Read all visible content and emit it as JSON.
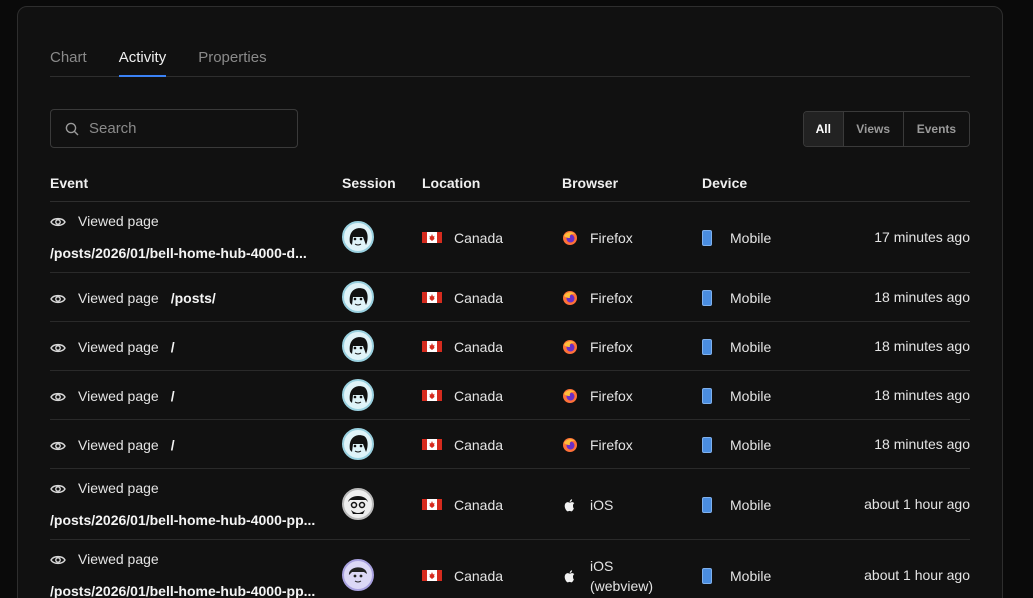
{
  "tabs": [
    {
      "label": "Chart",
      "active": false
    },
    {
      "label": "Activity",
      "active": true
    },
    {
      "label": "Properties",
      "active": false
    }
  ],
  "search": {
    "placeholder": "Search",
    "value": ""
  },
  "filter": {
    "options": [
      "All",
      "Views",
      "Events"
    ],
    "selected": "All"
  },
  "columns": {
    "event": "Event",
    "session": "Session",
    "location": "Location",
    "browser": "Browser",
    "device": "Device"
  },
  "colors": {
    "accent": "#3b82f6",
    "background": "#111111"
  },
  "rows": [
    {
      "event": "Viewed page",
      "path": "/posts/2026/01/bell-home-hub-4000-d...",
      "avatar": "avatar-a",
      "location": "Canada",
      "browser": "Firefox",
      "browser_icon": "firefox-icon",
      "device": "Mobile",
      "time": "17 minutes ago",
      "twoLine": true
    },
    {
      "event": "Viewed page",
      "path": "/posts/",
      "avatar": "avatar-a",
      "location": "Canada",
      "browser": "Firefox",
      "browser_icon": "firefox-icon",
      "device": "Mobile",
      "time": "18 minutes ago",
      "twoLine": false
    },
    {
      "event": "Viewed page",
      "path": "/",
      "avatar": "avatar-a",
      "location": "Canada",
      "browser": "Firefox",
      "browser_icon": "firefox-icon",
      "device": "Mobile",
      "time": "18 minutes ago",
      "twoLine": false
    },
    {
      "event": "Viewed page",
      "path": "/",
      "avatar": "avatar-a",
      "location": "Canada",
      "browser": "Firefox",
      "browser_icon": "firefox-icon",
      "device": "Mobile",
      "time": "18 minutes ago",
      "twoLine": false
    },
    {
      "event": "Viewed page",
      "path": "/",
      "avatar": "avatar-a",
      "location": "Canada",
      "browser": "Firefox",
      "browser_icon": "firefox-icon",
      "device": "Mobile",
      "time": "18 minutes ago",
      "twoLine": false
    },
    {
      "event": "Viewed page",
      "path": "/posts/2026/01/bell-home-hub-4000-pp...",
      "avatar": "avatar-b",
      "location": "Canada",
      "browser": "iOS",
      "browser_icon": "apple-icon",
      "device": "Mobile",
      "time": "about 1 hour ago",
      "twoLine": true
    },
    {
      "event": "Viewed page",
      "path": "/posts/2026/01/bell-home-hub-4000-pp...",
      "avatar": "avatar-c",
      "location": "Canada",
      "browser": "iOS\n(webview)",
      "browser_icon": "apple-icon",
      "device": "Mobile",
      "time": "about 1 hour ago",
      "twoLine": true
    }
  ]
}
